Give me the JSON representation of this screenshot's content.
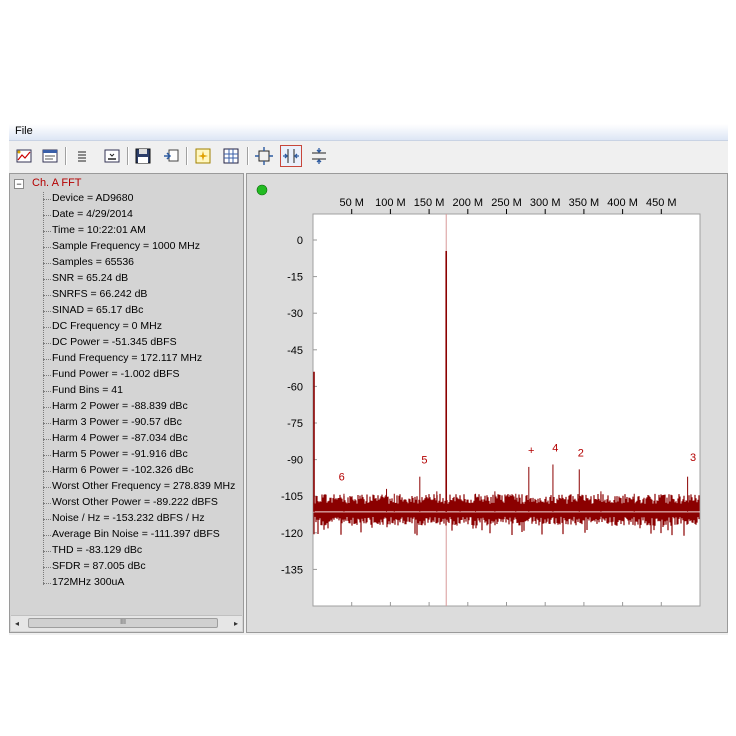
{
  "menu": {
    "file_label": "File"
  },
  "toolbar": {
    "buttons": [
      {
        "icon": "chart-wizard-icon"
      },
      {
        "icon": "window-icon"
      },
      {
        "icon": "list-icon"
      },
      {
        "icon": "window-minimize-icon"
      },
      {
        "icon": "save-icon"
      },
      {
        "icon": "import-icon"
      },
      {
        "icon": "sparkle-icon"
      },
      {
        "icon": "grid-icon"
      },
      {
        "icon": "zoom-fit-icon"
      },
      {
        "icon": "horizontal-zoom-icon"
      },
      {
        "icon": "vertical-zoom-icon"
      }
    ],
    "active_button": "horizontal-zoom-icon"
  },
  "tree": {
    "root_label": "Ch. A FFT",
    "expander": "−",
    "items": [
      "Device = AD9680",
      "Date = 4/29/2014",
      "Time = 10:22:01 AM",
      "Sample Frequency = 1000 MHz",
      "Samples = 65536",
      "SNR = 65.24 dB",
      "SNRFS = 66.242 dB",
      "SINAD = 65.17 dBc",
      "DC Frequency = 0 MHz",
      "DC Power = -51.345 dBFS",
      "Fund Frequency = 172.117 MHz",
      "Fund Power = -1.002 dBFS",
      "Fund Bins = 41",
      "Harm 2 Power = -88.839 dBc",
      "Harm 3 Power = -90.57 dBc",
      "Harm 4 Power = -87.034 dBc",
      "Harm 5 Power = -91.916 dBc",
      "Harm 6 Power = -102.326 dBc",
      "Worst Other Frequency = 278.839 MHz",
      "Worst Other Power = -89.222 dBFS",
      "Noise / Hz = -153.232 dBFS / Hz",
      "Average Bin Noise = -111.397 dBFS",
      "THD = -83.129 dBc",
      "SFDR = 87.005 dBc",
      "172MHz 300uA"
    ],
    "scroll_left": "◂",
    "scroll_right": "▸",
    "scroll_thumb": "III"
  },
  "status_indicator_color": "#22bb22",
  "colors": {
    "trace": "#8b0000",
    "marker_text": "#b40000",
    "fund_line": "#d89a9a"
  },
  "chart_data": {
    "type": "line",
    "xlabel": "",
    "ylabel": "",
    "x_range_mhz": [
      0,
      500
    ],
    "y_range_db": [
      0,
      -145
    ],
    "x_ticks": [
      {
        "v": 50,
        "label": "50 M"
      },
      {
        "v": 100,
        "label": "100 M"
      },
      {
        "v": 150,
        "label": "150 M"
      },
      {
        "v": 200,
        "label": "200 M"
      },
      {
        "v": 250,
        "label": "250 M"
      },
      {
        "v": 300,
        "label": "300 M"
      },
      {
        "v": 350,
        "label": "350 M"
      },
      {
        "v": 400,
        "label": "400 M"
      },
      {
        "v": 450,
        "label": "450 M"
      }
    ],
    "y_ticks": [
      {
        "v": 0,
        "label": "0"
      },
      {
        "v": -15,
        "label": "-15"
      },
      {
        "v": -30,
        "label": "-30"
      },
      {
        "v": -45,
        "label": "-45"
      },
      {
        "v": -60,
        "label": "-60"
      },
      {
        "v": -75,
        "label": "-75"
      },
      {
        "v": -90,
        "label": "-90"
      },
      {
        "v": -105,
        "label": "-105"
      },
      {
        "v": -120,
        "label": "-120"
      },
      {
        "v": -135,
        "label": "-135"
      }
    ],
    "noise_floor_db": -111.4,
    "fundamental": {
      "freq": 172.117,
      "power": -4.5
    },
    "dc": {
      "freq": 0,
      "power": -54
    },
    "spurs": [
      {
        "freq": 40,
        "power": -104
      },
      {
        "freq": 105,
        "power": -104
      },
      {
        "freq": 138,
        "power": -97
      },
      {
        "freq": 160,
        "power": -103
      },
      {
        "freq": 210,
        "power": -104
      },
      {
        "freq": 235,
        "power": -103
      },
      {
        "freq": 278.839,
        "power": -93
      },
      {
        "freq": 310,
        "power": -92
      },
      {
        "freq": 344,
        "power": -94
      },
      {
        "freq": 372,
        "power": -103
      },
      {
        "freq": 415,
        "power": -104
      },
      {
        "freq": 484,
        "power": -97
      },
      {
        "freq": 95,
        "power": -102
      },
      {
        "freq": 262,
        "power": -104
      },
      {
        "freq": 190,
        "power": -105
      }
    ],
    "markers": [
      {
        "label": "6",
        "freq": 37,
        "power": -97
      },
      {
        "label": "5",
        "freq": 144,
        "power": -90
      },
      {
        "label": "+",
        "freq": 282,
        "power": -86
      },
      {
        "label": "4",
        "freq": 313,
        "power": -85
      },
      {
        "label": "2",
        "freq": 346,
        "power": -87
      },
      {
        "label": "3",
        "freq": 491,
        "power": -89
      }
    ]
  }
}
